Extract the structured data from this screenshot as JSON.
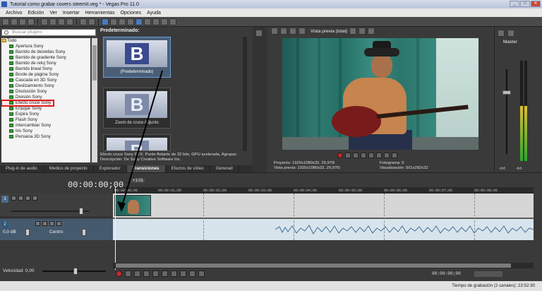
{
  "window": {
    "title": "Tutorial como grabar covers steemit.veg * - Vegas Pro 11.0"
  },
  "menu": [
    "Archivo",
    "Edición",
    "Ver",
    "Insertar",
    "Herramientas",
    "Opciones",
    "Ayuda"
  ],
  "explorer": {
    "search_placeholder": "Buscar plugins",
    "root": "Todo",
    "items": [
      "Apertura Sony",
      "Barrido de destellas Sony",
      "Barrido de gradiente Sony",
      "Barrido de reloj Sony",
      "Barrido lineal Sony",
      "Borde de página Sony",
      "Cascada en 3D Sony",
      "Deslizamiento Sony",
      "Disolución Sony",
      "División Sony",
      "Efecto cruce Sony",
      "Enjugar Sony",
      "Espira Sony",
      "Flash Sony",
      "Intercambiar Sony",
      "Iris Sony",
      "Persiana 3D Sony"
    ],
    "highlighted_index": 10
  },
  "transitions": {
    "header": "Predeterminado:",
    "cards": [
      {
        "label": "(Predeterminado)",
        "letter": "B"
      },
      {
        "label": "Zoom de cruce Adjunto",
        "letter": "B"
      },
      {
        "label": "",
        "letter": "B"
      }
    ],
    "description": "Efecto cruce Sony DFX. Punto flotante de 32 bits, GPU acelerada, Agrupac Descripción: De Sony Creative Software Inc."
  },
  "panel_tabs": [
    "Plug-in de audio",
    "Medios de proyecto",
    "Explorador",
    "Transiciones",
    "Efectos de vídeo",
    "Generad"
  ],
  "panel_tabs_active": 3,
  "preview": {
    "mode": "Vista previa (total)",
    "project_label": "Proyecto:",
    "project_value": "1920x1080x32, 29,970i",
    "preview_label": "Vista previa:",
    "preview_value": "1920x1080x32, 29,970i",
    "frame_label": "Fotograma:",
    "frame_value": "0",
    "view_label": "Visualización:",
    "view_value": "501x282x32"
  },
  "master": {
    "label": "Master",
    "left_val": "-Inf.",
    "right_val": "-Inf."
  },
  "timeline": {
    "timecode": "00:00:00;00",
    "ruler_ticks": [
      "00:00:00;00",
      "00:00:01;00",
      "00:00:02;00",
      "00:00:03;00",
      "00:00:04;00",
      "00:00:05;00",
      "00:00:06;00",
      "00:00:07;00",
      "00:00:08;00"
    ],
    "marker": "+1:01"
  },
  "tracks": {
    "video_num": "1",
    "audio_num": "2",
    "vol_label": "0,0 dB",
    "pan_label": "Centro"
  },
  "rate": {
    "label": "Velocidad: 0,00"
  },
  "transport_time": "00:00:00;00",
  "status": {
    "text": "Tiempo de grabación (2 canales): 23:52:30"
  }
}
